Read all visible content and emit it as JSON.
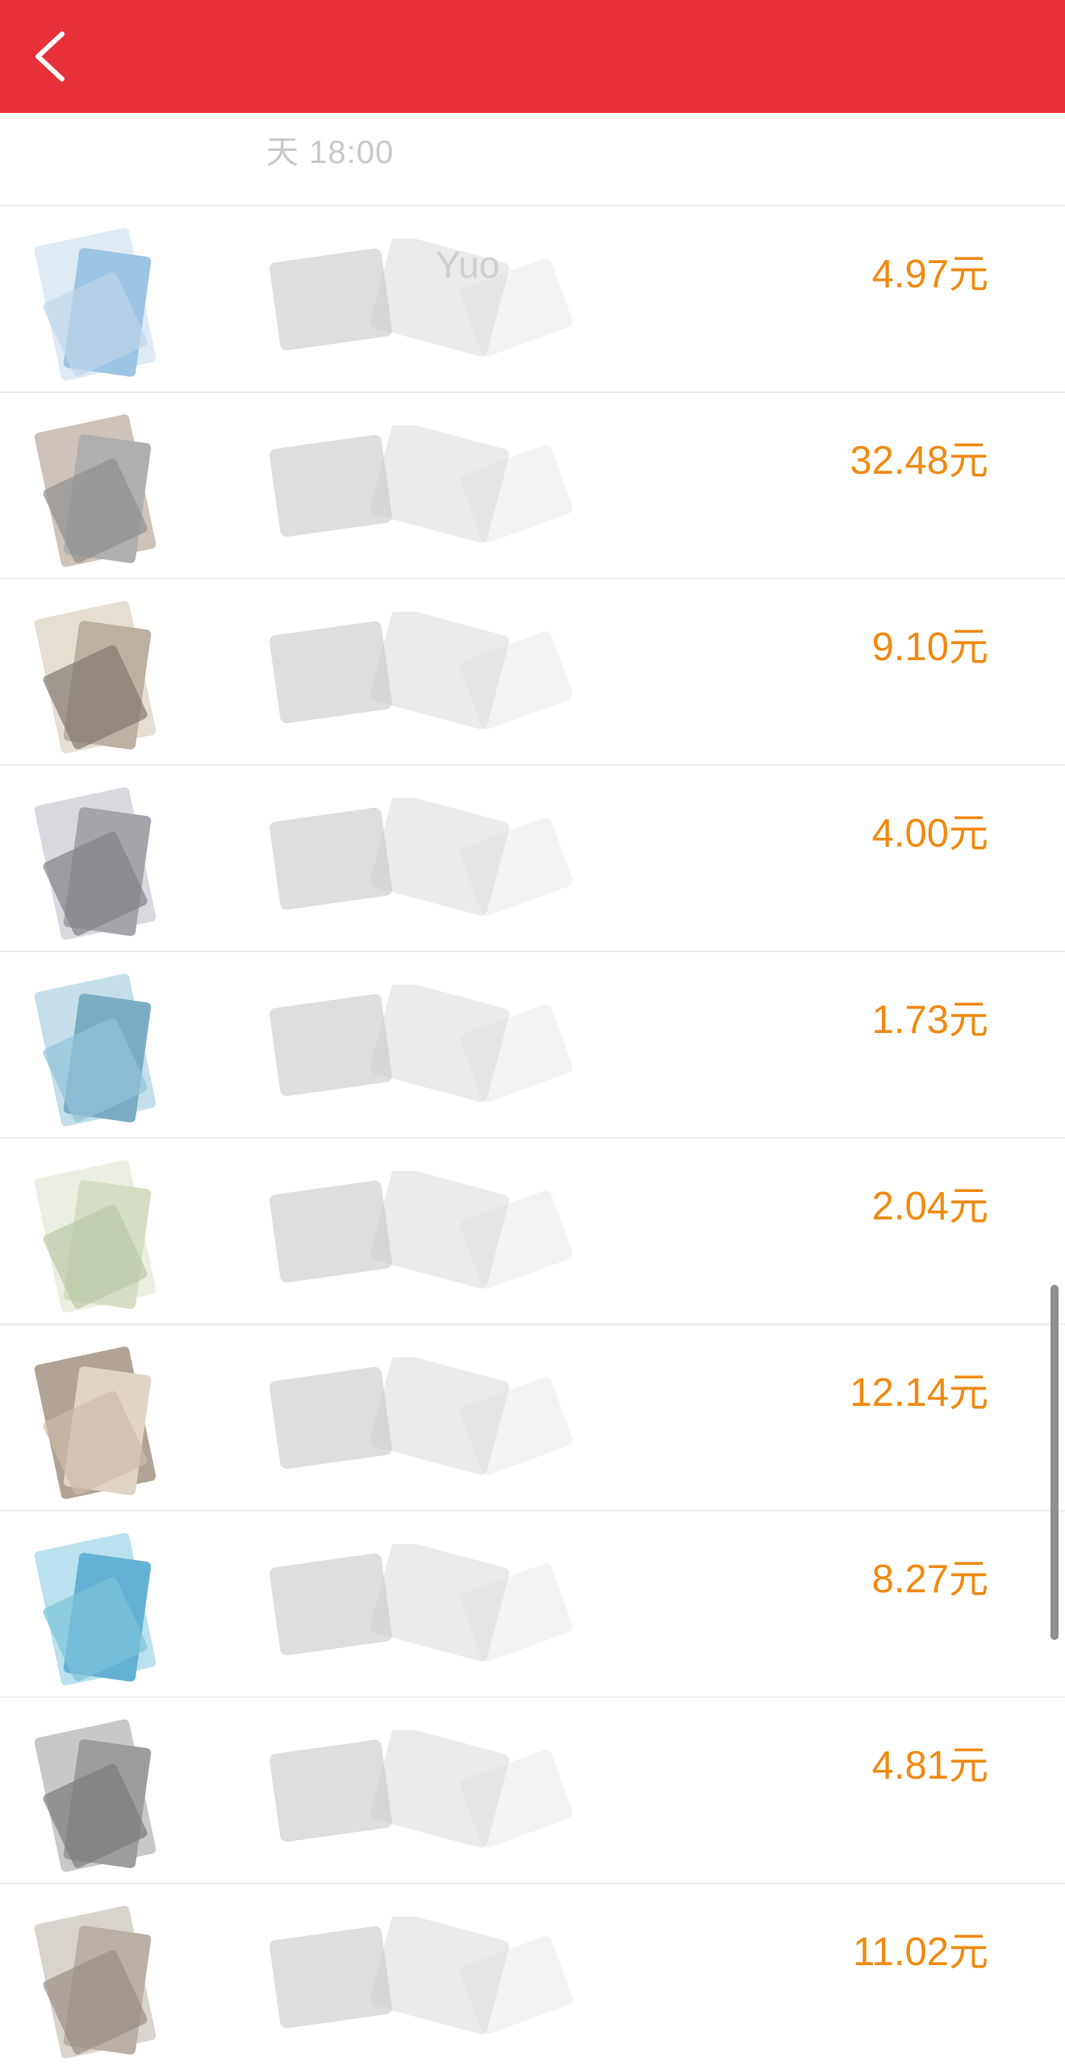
{
  "theme": {
    "header_bg": "#e8303a",
    "amount_color": "#f08a11"
  },
  "header": {
    "back_icon": "chevron-left-icon"
  },
  "time_row": {
    "text": "天 18:00"
  },
  "rows": [
    {
      "name": "Yuo",
      "amount": "4.97元"
    },
    {
      "name": "",
      "amount": "32.48元"
    },
    {
      "name": "",
      "amount": "9.10元"
    },
    {
      "name": "",
      "amount": "4.00元"
    },
    {
      "name": "",
      "amount": "1.73元"
    },
    {
      "name": "",
      "amount": "2.04元"
    },
    {
      "name": "",
      "amount": "12.14元"
    },
    {
      "name": "",
      "amount": "8.27元"
    },
    {
      "name": "",
      "amount": "4.81元"
    },
    {
      "name": "",
      "amount": "11.02元"
    }
  ]
}
